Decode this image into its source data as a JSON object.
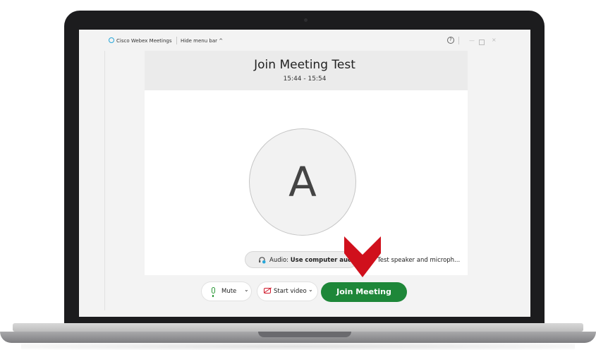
{
  "titlebar": {
    "app_name": "Cisco Webex Meetings",
    "hide_menu_label": "Hide menu bar ^",
    "help_glyph": "?",
    "minimize_glyph": "—",
    "close_glyph": "×"
  },
  "meeting": {
    "title": "Join Meeting Test",
    "time_range": "15:44 - 15:54",
    "avatar_initial": "A"
  },
  "audio": {
    "prefix": "Audio: ",
    "value": "Use computer audio",
    "chevron": "⌄",
    "test_label": "Test speaker and microph..."
  },
  "controls": {
    "mute_label": "Mute",
    "mute_chevron": "⌄",
    "video_label": "Start video",
    "video_chevron": "⌄",
    "join_label": "Join Meeting"
  },
  "colors": {
    "join_green": "#1e8739",
    "arrow_red": "#d0101c",
    "mic_green": "#2f9a3b",
    "video_red": "#d0182a"
  },
  "icons": [
    "webex-logo-icon",
    "help-icon",
    "minimize-icon",
    "maximize-icon",
    "close-icon",
    "audio-icon",
    "chevron-down-icon",
    "gear-icon",
    "microphone-icon",
    "video-off-icon",
    "red-arrow-icon"
  ]
}
